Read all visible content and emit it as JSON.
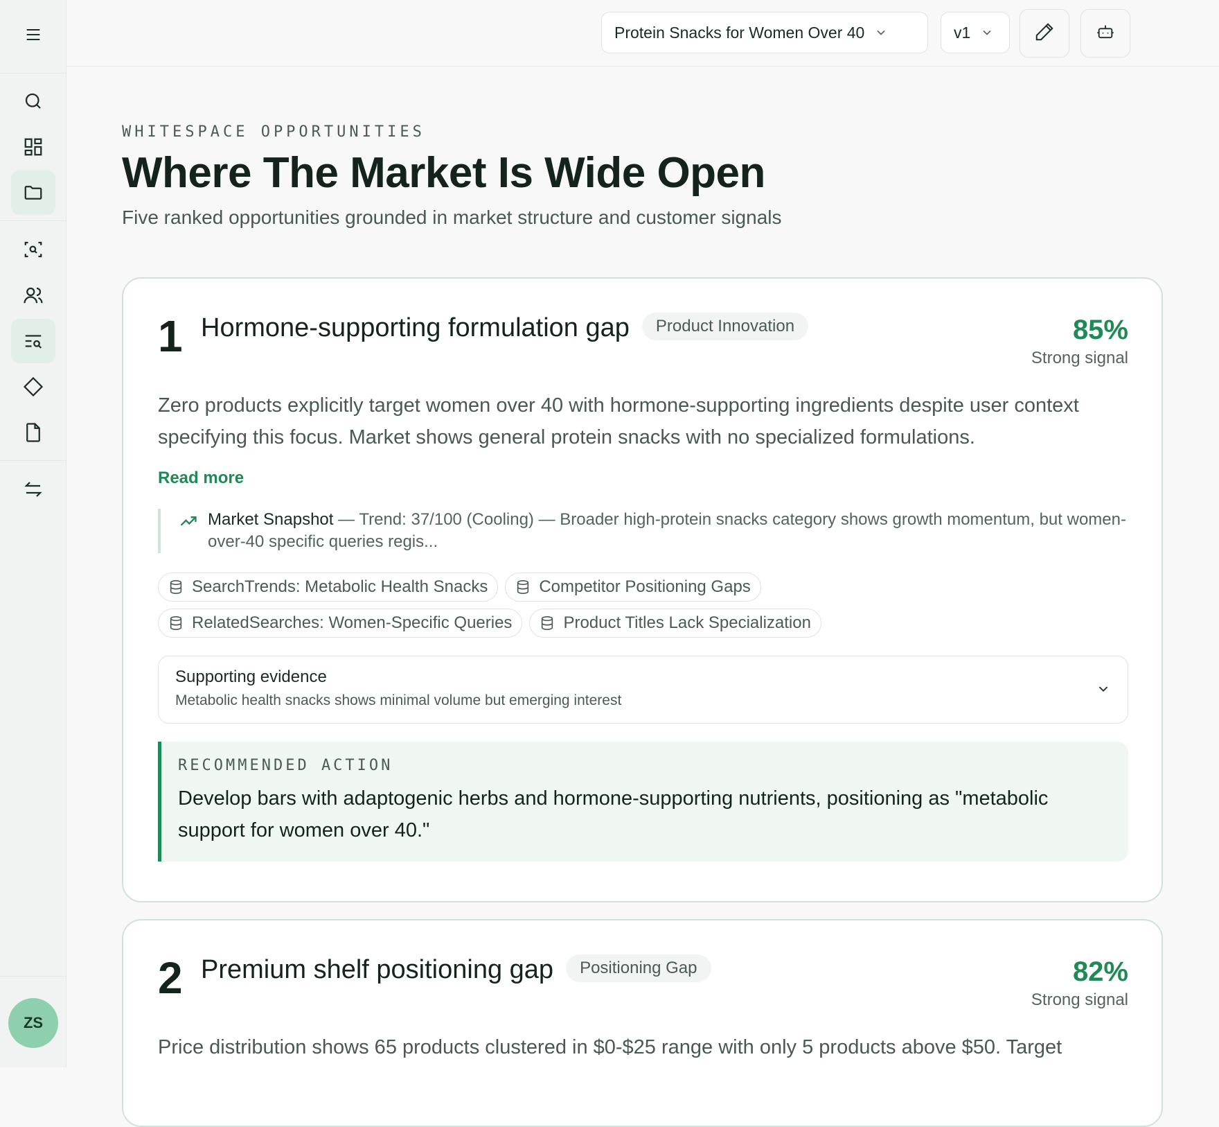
{
  "topbar": {
    "project_select": "Protein Snacks for Women Over 40",
    "version_select": "v1"
  },
  "header": {
    "kicker": "WHITESPACE OPPORTUNITIES",
    "title": "Where The Market Is Wide Open",
    "subtitle": "Five ranked opportunities grounded in market structure and customer signals"
  },
  "sidebar": {
    "avatar_initials": "ZS",
    "icons": [
      "menu-icon",
      "search-icon",
      "dashboard-icon",
      "folder-icon",
      "scan-search-icon",
      "users-icon",
      "text-search-icon",
      "diamond-icon",
      "file-icon",
      "arrows-swap-icon",
      "pencil-icon",
      "bot-icon"
    ]
  },
  "cards": [
    {
      "rank": "1",
      "title": "Hormone-supporting formulation gap",
      "tag": "Product Innovation",
      "score": "85%",
      "signal": "Strong signal",
      "description": "Zero products explicitly target women over 40 with hormone-supporting ingredients despite user context specifying this focus. Market shows general protein snacks with no specialized formulations.",
      "read_more": "Read more",
      "snapshot_label": "Market Snapshot",
      "snapshot_text": " — Trend: 37/100 (Cooling) — Broader high-protein snacks category shows growth momentum, but women-over-40 specific queries regis...",
      "sources": [
        "SearchTrends: Metabolic Health Snacks",
        "Competitor Positioning Gaps",
        "RelatedSearches: Women-Specific Queries",
        "Product Titles Lack Specialization"
      ],
      "evidence_title": "Supporting evidence",
      "evidence_text": "Metabolic health snacks shows minimal volume but emerging interest",
      "action_label": "RECOMMENDED ACTION",
      "action_text": "Develop bars with adaptogenic herbs and hormone-supporting nutrients, positioning as \"metabolic support for women over 40.\""
    },
    {
      "rank": "2",
      "title": "Premium shelf positioning gap",
      "tag": "Positioning Gap",
      "score": "82%",
      "signal": "Strong signal",
      "description": "Price distribution shows 65 products clustered in $0-$25 range with only 5 products above $50. Target"
    }
  ],
  "colors": {
    "accent": "#1f8a55",
    "border": "#cfe3d8"
  }
}
